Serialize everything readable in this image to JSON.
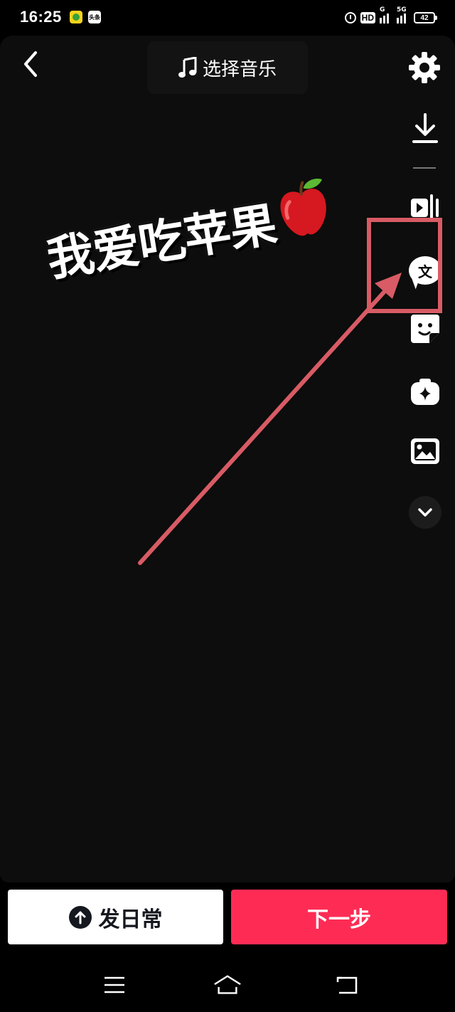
{
  "status_bar": {
    "time": "16:25",
    "hd_label": "HD",
    "network_label": "5G",
    "signal_label": "G",
    "battery_level": "42",
    "app_icon_2_label": "头条"
  },
  "header": {
    "music_label": "选择音乐"
  },
  "canvas": {
    "sticker_text": "我爱吃苹果"
  },
  "toolbar": {
    "text_tool_label": "文"
  },
  "footer": {
    "daily_label": "发日常",
    "next_label": "下一步"
  },
  "colors": {
    "accent": "#fe2c55",
    "annotation": "#d85b65",
    "canvas_bg": "#0c0d0c"
  }
}
